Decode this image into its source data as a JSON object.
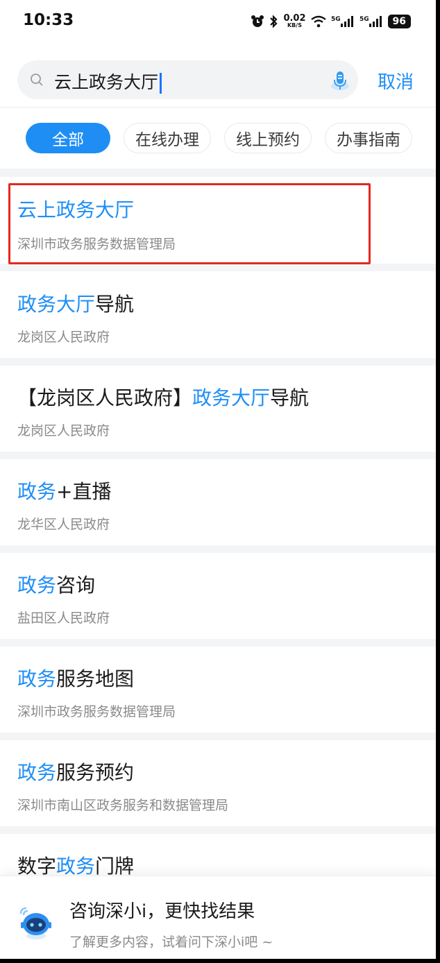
{
  "status_bar": {
    "time": "10:33",
    "net_speed_value": "0.02",
    "net_speed_unit": "KB/S",
    "sim1": "5G",
    "sim2": "5G",
    "battery": "96"
  },
  "search": {
    "query": "云上政务大厅",
    "cancel_label": "取消"
  },
  "tabs": [
    {
      "label": "全部",
      "active": true
    },
    {
      "label": "在线办理",
      "active": false
    },
    {
      "label": "线上预约",
      "active": false
    },
    {
      "label": "办事指南",
      "active": false
    }
  ],
  "results": [
    {
      "pre": "",
      "hl": "云上政务大厅",
      "post": "",
      "sub": "深圳市政务服务数据管理局"
    },
    {
      "pre": "",
      "hl": "政务大厅",
      "post": "导航",
      "sub": "龙岗区人民政府"
    },
    {
      "pre": "【龙岗区人民政府】",
      "hl": "政务大厅",
      "post": "导航",
      "sub": "龙岗区人民政府"
    },
    {
      "pre": "",
      "hl": "政务",
      "post": "+直播",
      "sub": "龙华区人民政府"
    },
    {
      "pre": "",
      "hl": "政务",
      "post": "咨询",
      "sub": "盐田区人民政府"
    },
    {
      "pre": "",
      "hl": "政务",
      "post": "服务地图",
      "sub": "深圳市政务服务数据管理局"
    },
    {
      "pre": "",
      "hl": "政务",
      "post": "服务预约",
      "sub": "深圳市南山区政务服务和数据管理局"
    },
    {
      "pre": "数字",
      "hl": "政务",
      "post": "门牌",
      "sub": ""
    }
  ],
  "assistant": {
    "title": "咨询深小i，更快找结果",
    "subtitle": "了解更多内容，试着问下深小i吧 ~"
  },
  "colors": {
    "accent": "#1e8ef5",
    "highlight_border": "#e5261f",
    "secondary_text": "#8a8a8a"
  }
}
